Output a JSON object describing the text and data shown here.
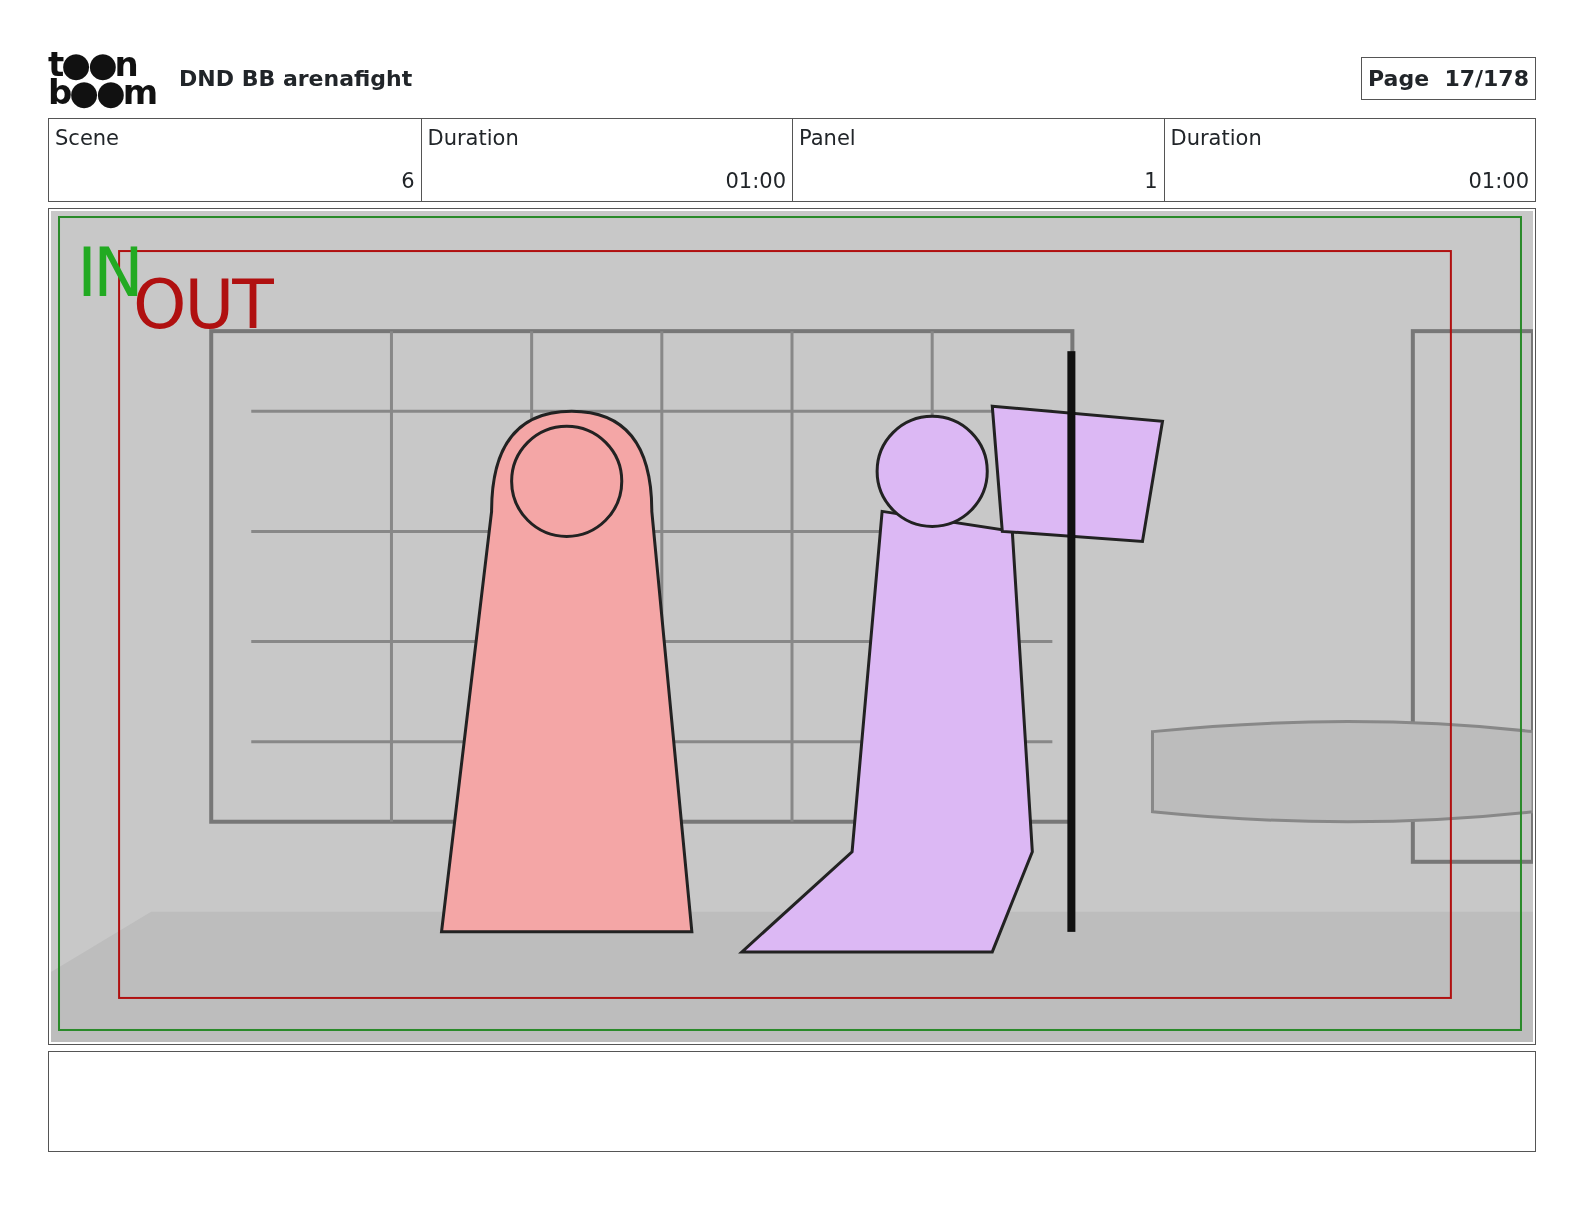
{
  "logo": [
    "t●●n",
    "b●●m"
  ],
  "title": "DND BB arenafight",
  "page": "Page  17/178",
  "info": {
    "labels": [
      "Scene",
      "Duration",
      "Panel",
      "Duration"
    ],
    "values": [
      "6",
      "01:00",
      "1",
      "01:00"
    ]
  },
  "panel": {
    "kind": "picture",
    "in_label": "IN",
    "out_label": "OUT"
  }
}
